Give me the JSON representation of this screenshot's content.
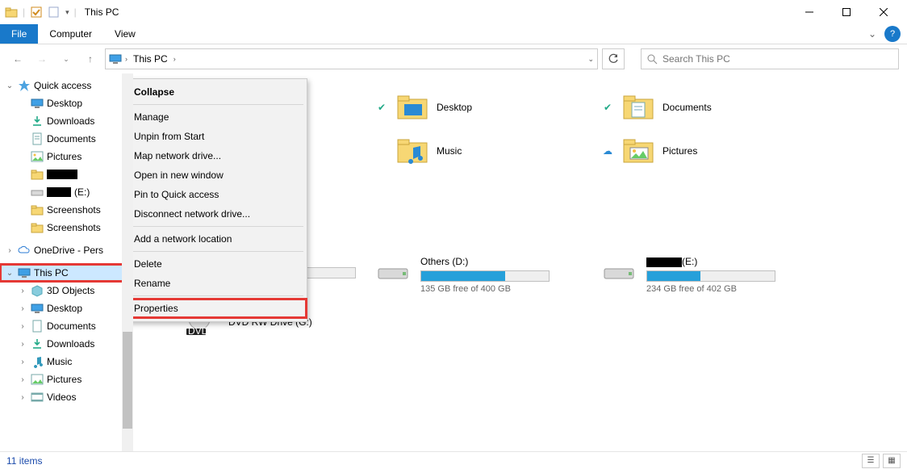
{
  "window": {
    "title": "This PC"
  },
  "ribbon": {
    "file": "File",
    "computer": "Computer",
    "view": "View"
  },
  "address": {
    "crumb1": "This PC",
    "search_placeholder": "Search This PC"
  },
  "tree": {
    "quick_access": "Quick access",
    "items_qa": [
      "Desktop",
      "Downloads",
      "Documents",
      "Pictures"
    ],
    "e_label": "(E:)",
    "screenshots": "Screenshots",
    "onedrive": "OneDrive - Pers",
    "thispc": "This PC",
    "items_pc": [
      "3D Objects",
      "Desktop",
      "Documents",
      "Downloads",
      "Music",
      "Pictures",
      "Videos"
    ]
  },
  "context_menu": {
    "collapse": "Collapse",
    "manage": "Manage",
    "unpin": "Unpin from Start",
    "map": "Map network drive...",
    "open_new": "Open in new window",
    "pin_qa": "Pin to Quick access",
    "disc": "Disconnect network drive...",
    "addloc": "Add a network location",
    "delete": "Delete",
    "rename": "Rename",
    "properties": "Properties"
  },
  "folders": {
    "desktop": "Desktop",
    "documents": "Documents",
    "music": "Music",
    "pictures": "Pictures"
  },
  "drives": {
    "others": {
      "name": "Others (D:)",
      "free": "135 GB free of 400 GB",
      "fill_pct": 66
    },
    "e": {
      "name_suffix": "(E:)",
      "free": "234 GB free of 402 GB",
      "fill_pct": 42
    },
    "dvd": {
      "name": "DVD RW Drive (G:)"
    }
  },
  "status": {
    "text": "11 items"
  }
}
